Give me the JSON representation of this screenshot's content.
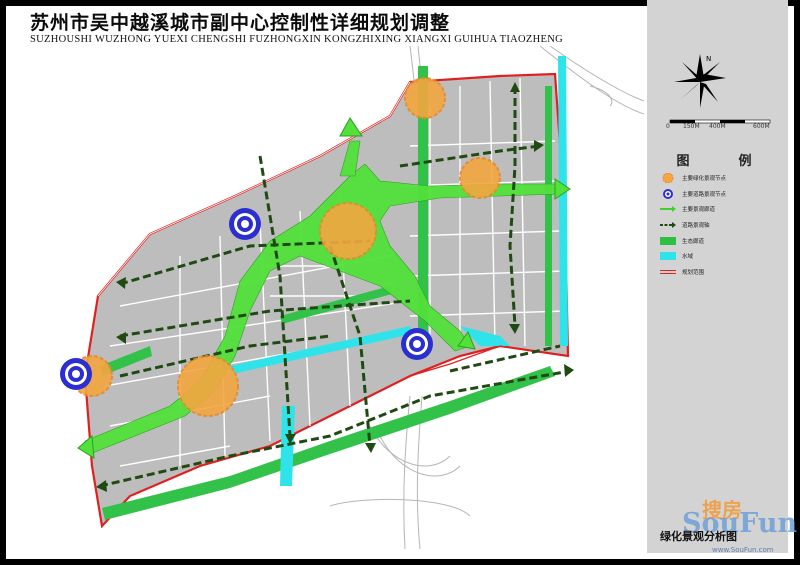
{
  "header": {
    "title": "苏州市吴中越溪城市副中心控制性详细规划调整",
    "subtitle": "SUZHOUSHI WUZHONG YUEXI CHENGSHI FUZHONGXIN KONGZHIXING XIANGXI GUIHUA TIAOZHENG"
  },
  "compass": {
    "north_label": "N"
  },
  "scale_bar": {
    "labels": [
      "0",
      "150M",
      "400M",
      "600M"
    ]
  },
  "legend": {
    "title": "图　例",
    "items": [
      {
        "label": "主要绿化景观节点",
        "symbol": "orange-circle-icon",
        "color": "#f4a640"
      },
      {
        "label": "主要道路景观节点",
        "symbol": "blue-target-icon",
        "color": "#2b2fd1"
      },
      {
        "label": "主要景观廊道",
        "symbol": "green-arrow-line-icon",
        "color": "#3fcf2f"
      },
      {
        "label": "道路景观轴",
        "symbol": "dashed-arrow-icon",
        "color": "#1f4a12"
      },
      {
        "label": "生态廊道",
        "symbol": "green-fill-icon",
        "color": "#2fbf45"
      },
      {
        "label": "水域",
        "symbol": "cyan-fill-icon",
        "color": "#2ee4ea"
      },
      {
        "label": "规划范围",
        "symbol": "red-double-line-icon",
        "color": "#e02020"
      }
    ]
  },
  "panel_title": "绿化景观分析图",
  "watermark": {
    "cn": "搜房",
    "en": "SouFun",
    "url": "www.SouFun.com"
  },
  "colors": {
    "planning_area": "#bdbdbd",
    "green_corridor": "#52e03a",
    "eco_corridor": "#32c24a",
    "water": "#2ee4ea",
    "landscape_node": "#f4a640",
    "road_node": "#2b2fd1",
    "axis": "#1f4a12",
    "boundary": "#e02020"
  }
}
